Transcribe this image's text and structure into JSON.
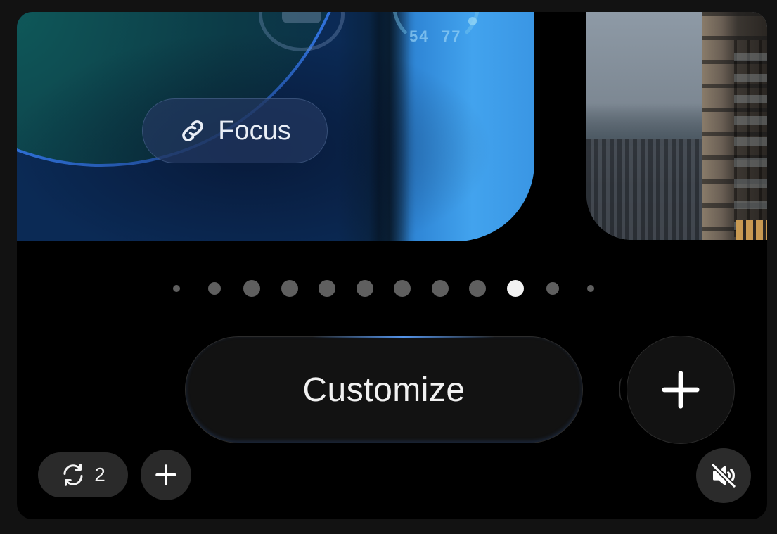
{
  "wallpaper_gallery": {
    "left_card": {
      "focus_label": "Focus",
      "focus_icon": "link-icon",
      "weather_low": "54",
      "weather_high": "77"
    },
    "right_card": {
      "image": "city-skyline-photo"
    },
    "page_indicator": {
      "count": 12,
      "active_index": 9
    }
  },
  "actions": {
    "customize_label": "Customize",
    "add_icon": "plus-icon"
  },
  "bottom_controls": {
    "shuffle_count": "2",
    "shuffle_icon": "refresh-icon",
    "add_icon": "plus-icon",
    "mute_icon": "speaker-muted-icon"
  },
  "colors": {
    "background": "#000000",
    "accent_blue": "#3f9ee8",
    "button_bg": "#121212",
    "control_bg": "#2a2a2a",
    "dot_inactive": "#5f5f5f",
    "dot_active": "#f2f2f2"
  }
}
